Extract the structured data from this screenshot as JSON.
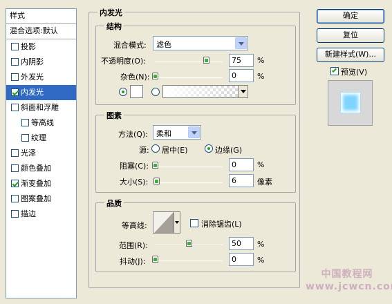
{
  "sidebar": {
    "header": "样式",
    "blend": "混合选项:默认",
    "items": [
      {
        "label": "投影",
        "checked": false
      },
      {
        "label": "内阴影",
        "checked": false
      },
      {
        "label": "外发光",
        "checked": false
      },
      {
        "label": "内发光",
        "checked": true,
        "active": true
      },
      {
        "label": "斜面和浮雕",
        "checked": false
      },
      {
        "label": "等高线",
        "checked": false,
        "sub": true
      },
      {
        "label": "纹理",
        "checked": false,
        "sub": true
      },
      {
        "label": "光泽",
        "checked": false
      },
      {
        "label": "颜色叠加",
        "checked": false
      },
      {
        "label": "渐变叠加",
        "checked": true
      },
      {
        "label": "图案叠加",
        "checked": false
      },
      {
        "label": "描边",
        "checked": false
      }
    ]
  },
  "panel": {
    "title": "内发光",
    "structure": {
      "title": "结构",
      "blend_mode_label": "混合模式:",
      "blend_mode_value": "滤色",
      "opacity_label": "不透明度(O):",
      "opacity_value": "75",
      "opacity_unit": "%",
      "opacity_level": 75,
      "noise_label": "杂色(N):",
      "noise_value": "0",
      "noise_unit": "%",
      "noise_level": 0
    },
    "elements": {
      "title": "图素",
      "method_label": "方法(Q):",
      "method_value": "柔和",
      "source_label": "源:",
      "source_center": "居中(E)",
      "source_edge": "边缘(G)",
      "choke_label": "阻塞(C):",
      "choke_value": "0",
      "choke_unit": "%",
      "choke_level": 0,
      "size_label": "大小(S):",
      "size_value": "6",
      "size_unit": "像素",
      "size_level": 6
    },
    "quality": {
      "title": "品质",
      "contour_label": "等高线:",
      "antialias_label": "消除锯齿(L)",
      "range_label": "范围(R):",
      "range_value": "50",
      "range_unit": "%",
      "range_level": 50,
      "jitter_label": "抖动(J):",
      "jitter_value": "0",
      "jitter_unit": "%",
      "jitter_level": 0
    }
  },
  "buttons": {
    "ok": "确定",
    "reset": "复位",
    "new_style": "新建样式(W)...",
    "preview": "预览(V)"
  },
  "watermark": "中国教程网 www.jcwcn.com",
  "colors": {
    "selection": "#316ac5",
    "glow_swatch": "#ffffff",
    "preview_fill": "#7fd4ff"
  }
}
